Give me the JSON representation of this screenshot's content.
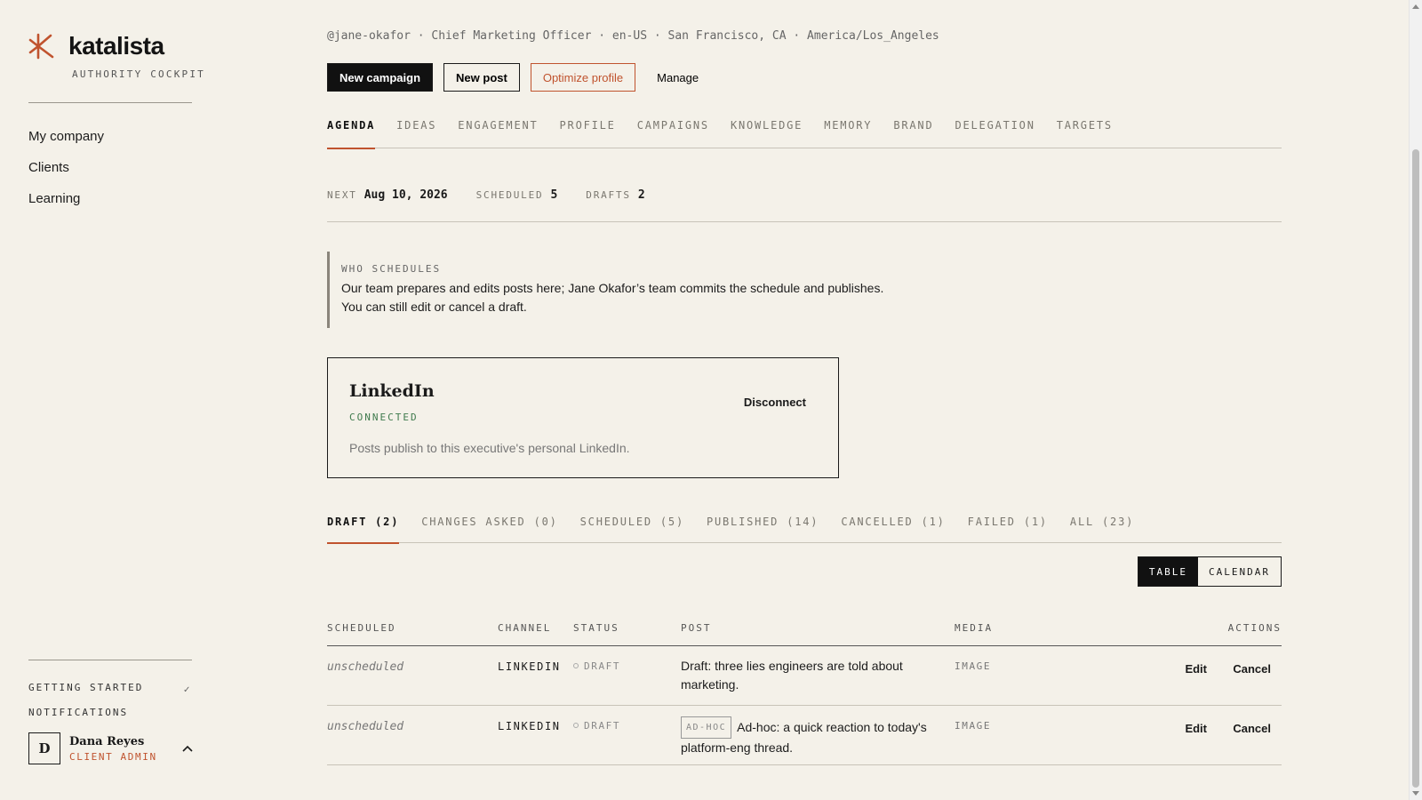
{
  "brand": {
    "name": "katalista",
    "subtitle": "AUTHORITY COCKPIT",
    "accent": "#c0532e"
  },
  "sidebar": {
    "nav": [
      "My company",
      "Clients",
      "Learning"
    ],
    "getting_started": "GETTING STARTED",
    "getting_started_check": "✓",
    "notifications": "NOTIFICATIONS",
    "user": {
      "initial": "D",
      "name": "Dana Reyes",
      "role": "CLIENT ADMIN"
    }
  },
  "header": {
    "meta": "@jane-okafor · Chief Marketing Officer · en-US · San Francisco, CA · America/Los_Angeles",
    "buttons": {
      "new_campaign": "New campaign",
      "new_post": "New post",
      "optimize": "Optimize profile",
      "manage": "Manage"
    }
  },
  "tabs": [
    "AGENDA",
    "IDEAS",
    "ENGAGEMENT",
    "PROFILE",
    "CAMPAIGNS",
    "KNOWLEDGE",
    "MEMORY",
    "BRAND",
    "DELEGATION",
    "TARGETS"
  ],
  "summary": {
    "next_label": "NEXT",
    "next_value": "Aug 10, 2026",
    "scheduled_label": "SCHEDULED",
    "scheduled_value": "5",
    "drafts_label": "DRAFTS",
    "drafts_value": "2"
  },
  "callout": {
    "title": "WHO SCHEDULES",
    "line1": "Our team prepares and edits posts here; Jane Okafor’s team commits the schedule and publishes.",
    "line2": "You can still edit or cancel a draft."
  },
  "channel_card": {
    "title": "LinkedIn",
    "status": "CONNECTED",
    "description": "Posts publish to this executive's personal LinkedIn.",
    "action": "Disconnect"
  },
  "status_tabs": [
    "DRAFT (2)",
    "CHANGES ASKED (0)",
    "SCHEDULED (5)",
    "PUBLISHED (14)",
    "CANCELLED (1)",
    "FAILED (1)",
    "ALL (23)"
  ],
  "view_toggle": {
    "table": "TABLE",
    "calendar": "CALENDAR"
  },
  "table": {
    "headers": {
      "scheduled": "SCHEDULED",
      "channel": "CHANNEL",
      "status": "STATUS",
      "post": "POST",
      "media": "MEDIA",
      "actions": "ACTIONS"
    },
    "rows": [
      {
        "scheduled": "unscheduled",
        "channel": "LINKEDIN",
        "status": "DRAFT",
        "tag": "",
        "post": "Draft: three lies engineers are told about marketing.",
        "media": "IMAGE",
        "edit": "Edit",
        "cancel": "Cancel"
      },
      {
        "scheduled": "unscheduled",
        "channel": "LINKEDIN",
        "status": "DRAFT",
        "tag": "AD-HOC",
        "post": "Ad-hoc: a quick reaction to today's platform-eng thread.",
        "media": "IMAGE",
        "edit": "Edit",
        "cancel": "Cancel"
      }
    ]
  }
}
